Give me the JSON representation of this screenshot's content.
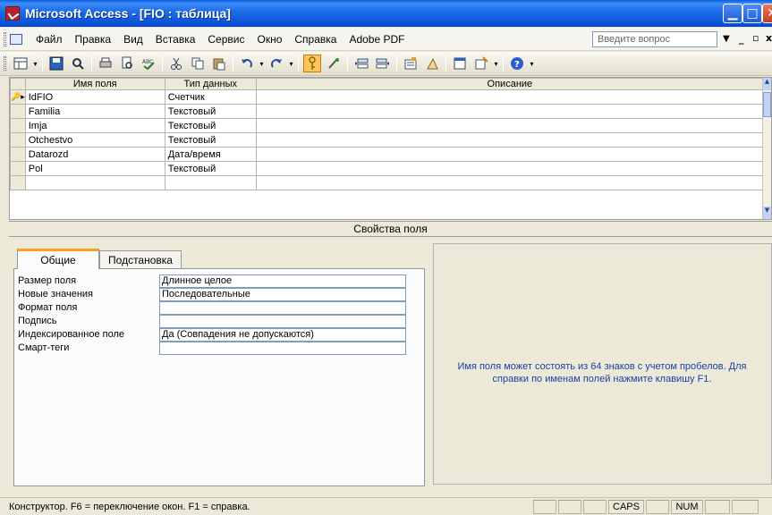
{
  "window": {
    "title": "Microsoft Access - [FIO : таблица]"
  },
  "menu": {
    "items": [
      "Файл",
      "Правка",
      "Вид",
      "Вставка",
      "Сервис",
      "Окно",
      "Справка",
      "Adobe PDF"
    ],
    "help_placeholder": "Введите вопрос"
  },
  "toolbar": {
    "icons": [
      "view-icon",
      "save-icon",
      "search-icon",
      "print-icon",
      "print-preview-icon",
      "spelling-icon",
      "cut-icon",
      "copy-icon",
      "paste-icon",
      "undo-icon",
      "redo-icon",
      "primary-key-icon",
      "build-icon",
      "insert-rows-icon",
      "delete-rows-icon",
      "properties-icon",
      "build-wizard-icon",
      "database-window-icon",
      "new-object-icon",
      "help-icon"
    ]
  },
  "grid": {
    "headers": [
      "Имя поля",
      "Тип данных",
      "Описание"
    ],
    "rows": [
      {
        "name": "IdFIO",
        "type": "Счетчик",
        "desc": "",
        "key": "🔑"
      },
      {
        "name": "Familia",
        "type": "Текстовый",
        "desc": ""
      },
      {
        "name": "Imja",
        "type": "Текстовый",
        "desc": ""
      },
      {
        "name": "Otchestvo",
        "type": "Текстовый",
        "desc": ""
      },
      {
        "name": "Datarozd",
        "type": "Дата/время",
        "desc": ""
      },
      {
        "name": "Pol",
        "type": "Текстовый",
        "desc": ""
      }
    ]
  },
  "properties": {
    "header": "Свойства поля",
    "tabs": [
      "Общие",
      "Подстановка"
    ],
    "rows": [
      {
        "label": "Размер поля",
        "value": "Длинное целое"
      },
      {
        "label": "Новые значения",
        "value": "Последовательные"
      },
      {
        "label": "Формат поля",
        "value": ""
      },
      {
        "label": "Подпись",
        "value": ""
      },
      {
        "label": "Индексированное поле",
        "value": "Да (Совпадения не допускаются)"
      },
      {
        "label": "Смарт-теги",
        "value": ""
      }
    ],
    "help_text": "Имя поля может состоять из 64 знаков с учетом пробелов.  Для справки по именам полей нажмите клавишу F1."
  },
  "status": {
    "text": "Конструктор.  F6 = переключение окон.  F1 = справка.",
    "caps": "CAPS",
    "num": "NUM"
  }
}
